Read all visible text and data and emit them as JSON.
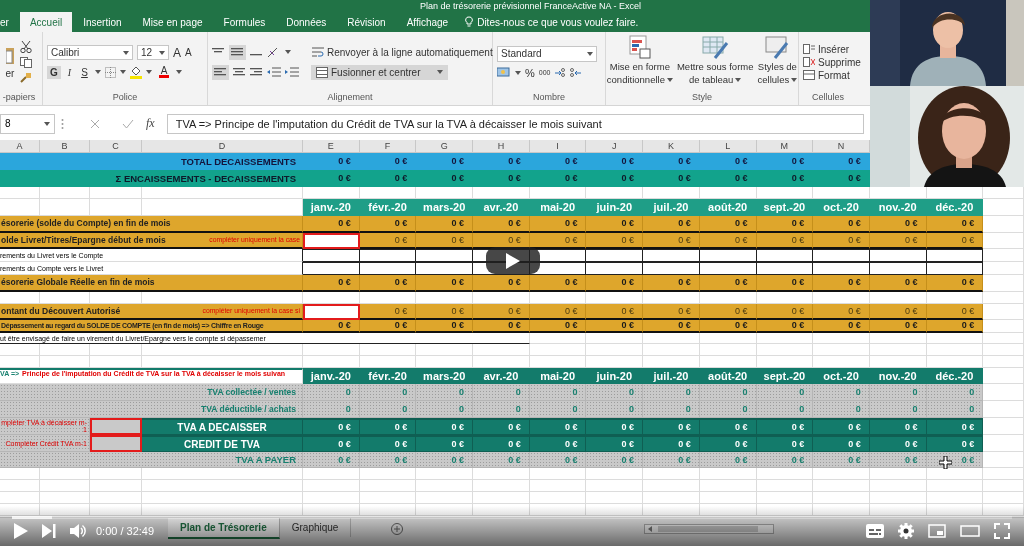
{
  "window": {
    "title": "Plan de trésorerie prévisionnel FranceActive NA - Excel"
  },
  "ribbon_tabs": [
    {
      "label": "er",
      "selected": false
    },
    {
      "label": "Accueil",
      "selected": true
    },
    {
      "label": "Insertion",
      "selected": false
    },
    {
      "label": "Mise en page",
      "selected": false
    },
    {
      "label": "Formules",
      "selected": false
    },
    {
      "label": "Données",
      "selected": false
    },
    {
      "label": "Révision",
      "selected": false
    },
    {
      "label": "Affichage",
      "selected": false
    }
  ],
  "tell_me": "Dites-nous ce que vous voulez faire.",
  "clipboard": {
    "paste": "er",
    "group": "-papiers"
  },
  "font": {
    "name": "Calibri",
    "size": "12",
    "grow": "A",
    "shrink": "A",
    "bold": "G",
    "italic": "I",
    "underline": "S",
    "font_color": "A",
    "group": "Police"
  },
  "alignment": {
    "wrap": "Renvoyer à la ligne automatiquement",
    "merge": "Fusionner et centrer",
    "group": "Alignement"
  },
  "number": {
    "format": "Standard",
    "percent": "%",
    "thousands": "000",
    "group": "Nombre"
  },
  "styles": {
    "buttons": [
      {
        "lines": [
          "Mise en forme",
          "conditionnelle"
        ]
      },
      {
        "lines": [
          "Mettre sous forme",
          "de tableau"
        ]
      },
      {
        "lines": [
          "Styles de",
          "cellules"
        ]
      }
    ],
    "group": "Style"
  },
  "cells": {
    "items": [
      "Insérer",
      "Supprime",
      "Format"
    ],
    "group": "Cellules"
  },
  "formula_bar": {
    "name_box": "8",
    "fx": "fx",
    "formula": "TVA => Principe de l'imputation du Crédit de TVA sur la TVA à décaisser le mois suivant"
  },
  "sheet": {
    "columns": [
      "A",
      "B",
      "C",
      "D",
      "E",
      "F",
      "G",
      "H",
      "I",
      "J",
      "K",
      "L",
      "M",
      "N"
    ],
    "rows": [
      {
        "kind": "total",
        "label": "TOTAL DECAISSEMENTS",
        "values": [
          "0 €",
          "0 €",
          "0 €",
          "0 €",
          "0 €",
          "0 €",
          "0 €",
          "0 €",
          "0 €",
          "0 €"
        ]
      },
      {
        "kind": "sum",
        "label": "Σ ENCAISSEMENTS - DECAISSEMENTS",
        "values": [
          "0 €",
          "0 €",
          "0 €",
          "0 €",
          "0 €",
          "0 €",
          "0 €",
          "0 €",
          "0 €",
          "0 €"
        ]
      },
      {
        "kind": "blank"
      },
      {
        "kind": "months",
        "values": [
          "janv.-20",
          "févr.-20",
          "mars-20",
          "avr.-20",
          "mai-20",
          "juin-20",
          "juil.-20",
          "août-20",
          "sept.-20",
          "oct.-20",
          "nov.-20",
          "déc.-20"
        ]
      },
      {
        "kind": "gold",
        "label": "ésorerie (solde du Compte) en fin de mois",
        "values": [
          "0 €",
          "0 €",
          "0 €",
          "0 €",
          "0 €",
          "0 €",
          "0 €",
          "0 €",
          "0 €",
          "0 €",
          "0 €",
          "0 €"
        ]
      },
      {
        "kind": "gold-input",
        "label": "olde Livret/Titres/Epargne début de mois",
        "note": "compléter uniquement la case",
        "values": [
          "0 €",
          "0 €",
          "0 €",
          "0 €",
          "0 €",
          "0 €",
          "0 €",
          "0 €",
          "0 €",
          "0 €",
          "0 €"
        ]
      },
      {
        "kind": "plain",
        "label": "rements du Livret vers le Compte"
      },
      {
        "kind": "plain",
        "label": "rements du Compte vers le Livret"
      },
      {
        "kind": "gold",
        "label": "ésorerie Globale Réelle en fin de mois",
        "values": [
          "0 €",
          "0 €",
          "0 €",
          "0 €",
          "0 €",
          "0 €",
          "0 €",
          "0 €",
          "0 €",
          "0 €",
          "0 €",
          "0 €"
        ]
      },
      {
        "kind": "blank"
      },
      {
        "kind": "gold-input",
        "label": "ontant du Découvert Autorisé",
        "note": "compléter uniquement la case si",
        "values": [
          "0 €",
          "0 €",
          "0 €",
          "0 €",
          "0 €",
          "0 €",
          "0 €",
          "0 €",
          "0 €",
          "0 €",
          "0 €"
        ]
      },
      {
        "kind": "gold-small",
        "label": "Dépassement au regard du SOLDE DE COMPTE (en fin de mois) => Chiffre en Rouge",
        "values": [
          "0 €",
          "0 €",
          "0 €",
          "0 €",
          "0 €",
          "0 €",
          "0 €",
          "0 €",
          "0 €",
          "0 €",
          "0 €",
          "0 €"
        ]
      },
      {
        "kind": "text",
        "label": "ut être envisagé de faire un virement du Livret/Epargne vers le compte si dépassemer"
      },
      {
        "kind": "blank"
      },
      {
        "kind": "blank"
      },
      {
        "kind": "tva-head",
        "prefix": "VA =>",
        "label": "Principe de l'imputation du Crédit de TVA sur la TVA à décaisser le mois suivan",
        "values": [
          "janv.-20",
          "févr.-20",
          "mars-20",
          "avr.-20",
          "mai-20",
          "juin-20",
          "juil.-20",
          "août-20",
          "sept.-20",
          "oct.-20",
          "nov.-20",
          "déc.-20"
        ]
      },
      {
        "kind": "dotted",
        "label": "TVA collectée / ventes",
        "values": [
          "0",
          "0",
          "0",
          "0",
          "0",
          "0",
          "0",
          "0",
          "0",
          "0",
          "0",
          "0"
        ]
      },
      {
        "kind": "dotted",
        "label": "TVA déductible / achats",
        "values": [
          "0",
          "0",
          "0",
          "0",
          "0",
          "0",
          "0",
          "0",
          "0",
          "0",
          "0",
          "0"
        ]
      },
      {
        "kind": "tva-input",
        "note": "mpléter TVA à décaisser m-1",
        "label": "TVA A DECAISSER",
        "values": [
          "0 €",
          "0 €",
          "0 €",
          "0 €",
          "0 €",
          "0 €",
          "0 €",
          "0 €",
          "0 €",
          "0 €",
          "0 €",
          "0 €"
        ]
      },
      {
        "kind": "tva-input",
        "note": "Compléter Crédit TVA m-1",
        "label": "CREDIT DE TVA",
        "values": [
          "0 €",
          "0 €",
          "0 €",
          "0 €",
          "0 €",
          "0 €",
          "0 €",
          "0 €",
          "0 €",
          "0 €",
          "0 €",
          "0 €"
        ]
      },
      {
        "kind": "dotted-total",
        "label": "TVA A PAYER",
        "values": [
          "0 €",
          "0 €",
          "0 €",
          "0 €",
          "0 €",
          "0 €",
          "0 €",
          "0 €",
          "0 €",
          "0 €",
          "0 €",
          "0 €"
        ]
      }
    ]
  },
  "sheet_tabs": [
    {
      "label": "Plan de Trésorerie",
      "selected": true
    },
    {
      "label": "Graphique",
      "selected": false
    }
  ],
  "player": {
    "time": "0:00 / 32:49",
    "buffer": {
      "level": 0.04
    }
  }
}
